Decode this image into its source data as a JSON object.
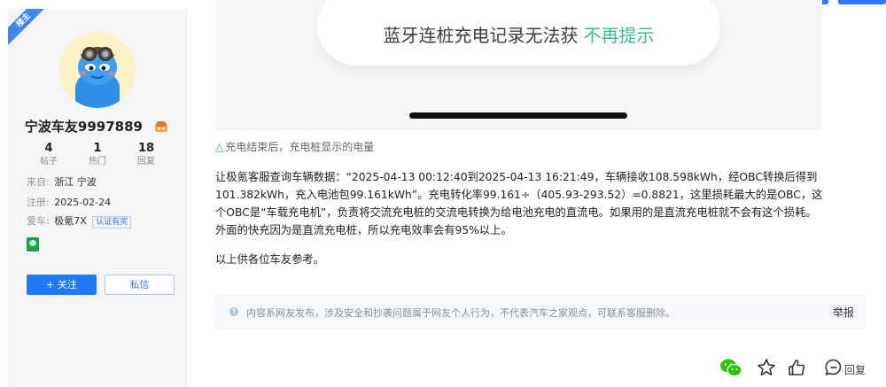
{
  "sidebar": {
    "role_ribbon": "楼主",
    "username": "宁波车友9997889",
    "stats": [
      {
        "value": "4",
        "label": "帖子"
      },
      {
        "value": "1",
        "label": "热门"
      },
      {
        "value": "18",
        "label": "回复"
      }
    ],
    "from_label": "来自:",
    "from_value": "浙江 宁波",
    "reg_label": "注册:",
    "reg_value": "2025-02-24",
    "car_label": "爱车:",
    "car_value": "极氪7X",
    "cert_label": "认证有奖",
    "follow_label": "+ 关注",
    "message_label": "私信"
  },
  "post": {
    "image_prompt_text": "蓝牙连桩充电记录无法获",
    "image_prompt_action": "不再提示",
    "caption_icon": "△",
    "caption": "充电结束后，充电桩显示的电量",
    "paragraph1": "让极氪客服查询车辆数据：“2025-04-13 00:12:40到2025-04-13 16:21:49，车辆接收108.598kWh，经OBC转换后得到101.382kWh，充入电池包99.161kWh”。充电转化率99.161÷（405.93-293.52）=0.8821，这里损耗最大的是OBC，这个OBC是“车载充电机”，负责将交流充电桩的交流电转换为给电池充电的直流电。如果用的是直流充电桩就不会有这个损耗。外面的快充因为是直流充电桩，所以充电效率会有95%以上。",
    "paragraph2": "以上供各位车友参考。",
    "notice_icon": "!",
    "notice": "内容系网友发布，涉及安全和抄袭问题属于网友个人行为，不代表汽车之家观点，可联系客服删除。",
    "report_label": "举报"
  },
  "actions": {
    "reply_label": "回复",
    "icons": [
      "wechat-icon",
      "star-icon",
      "like-icon",
      "reply-icon"
    ]
  },
  "colors": {
    "accent_blue": "#1f7bf5",
    "prompt_green": "#3dbb82",
    "wechat_green": "#2dc100"
  }
}
